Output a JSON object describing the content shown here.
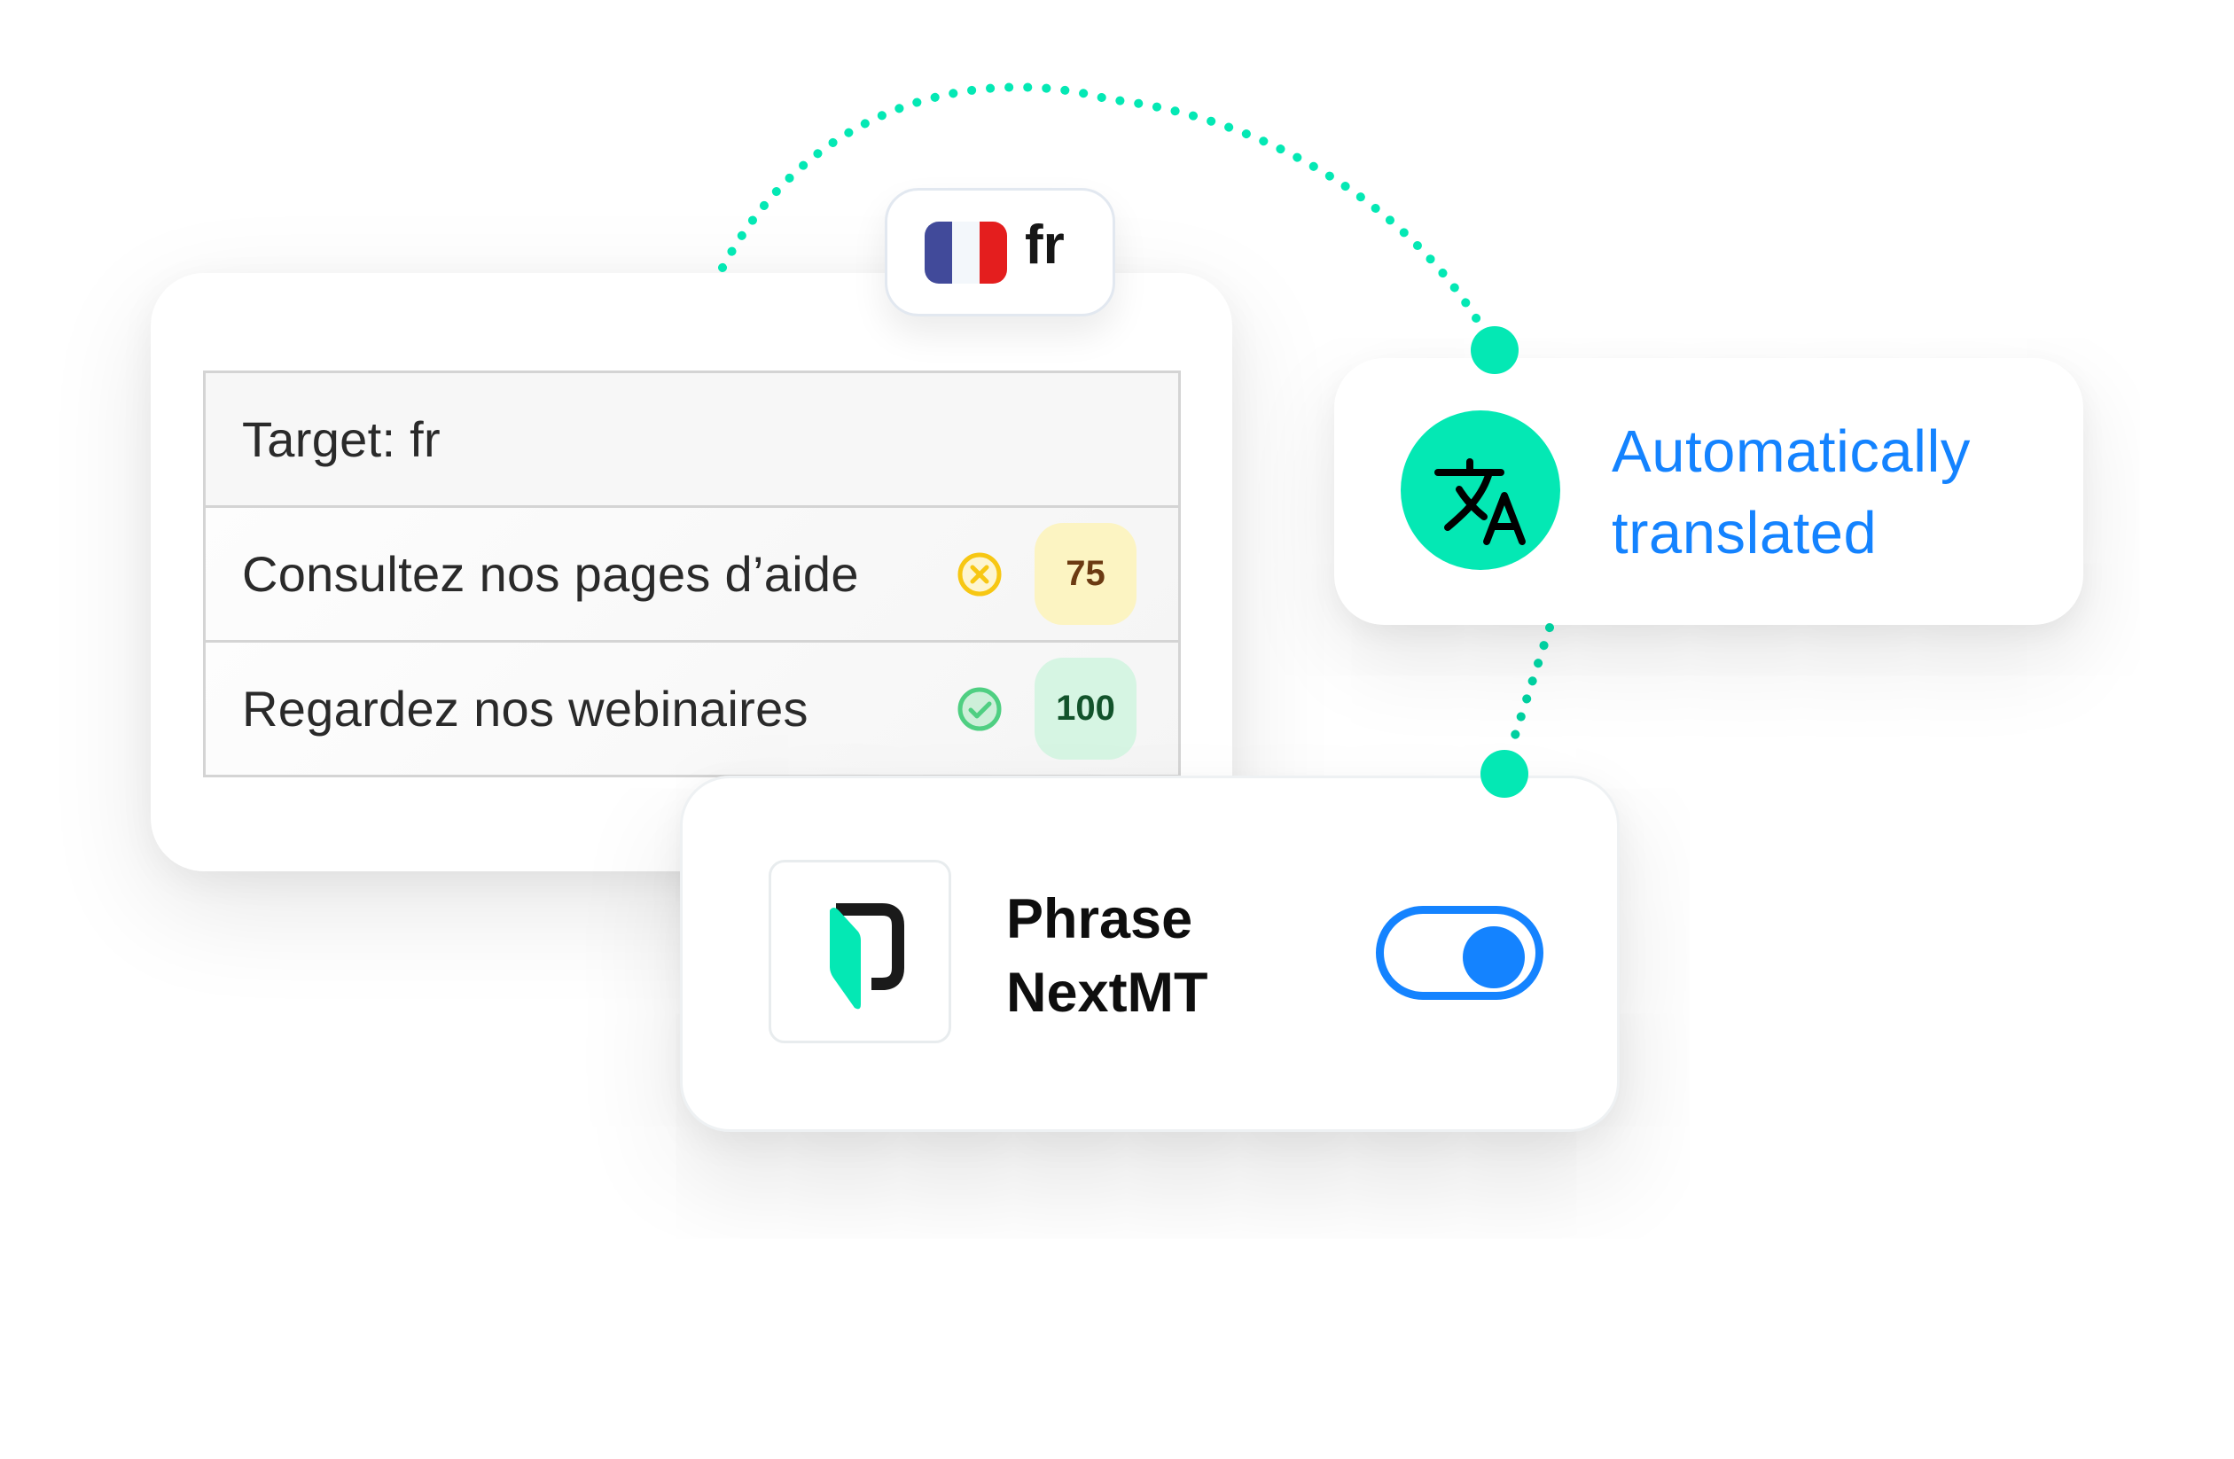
{
  "colors": {
    "accent_teal": "#04E8B4",
    "accent_blue": "#1483FF",
    "warning_yellow": "#F7C713",
    "success_green": "#4FCF82"
  },
  "language_chip": {
    "flag_icon": "france-flag-icon",
    "code": "fr"
  },
  "target_table": {
    "header": "Target: fr",
    "rows": [
      {
        "text": "Consultez nos pages d’aide",
        "status_icon": "x-circle-icon",
        "status": "warning",
        "score": "75"
      },
      {
        "text": "Regardez nos webinaires",
        "status_icon": "check-circle-icon",
        "status": "success",
        "score": "100"
      }
    ]
  },
  "auto_translate": {
    "icon": "translate-icon",
    "line1": "Automatically",
    "line2": "translated"
  },
  "engine": {
    "logo_icon": "phrase-logo-icon",
    "line1": "Phrase",
    "line2": "NextMT",
    "toggle_on": true
  }
}
